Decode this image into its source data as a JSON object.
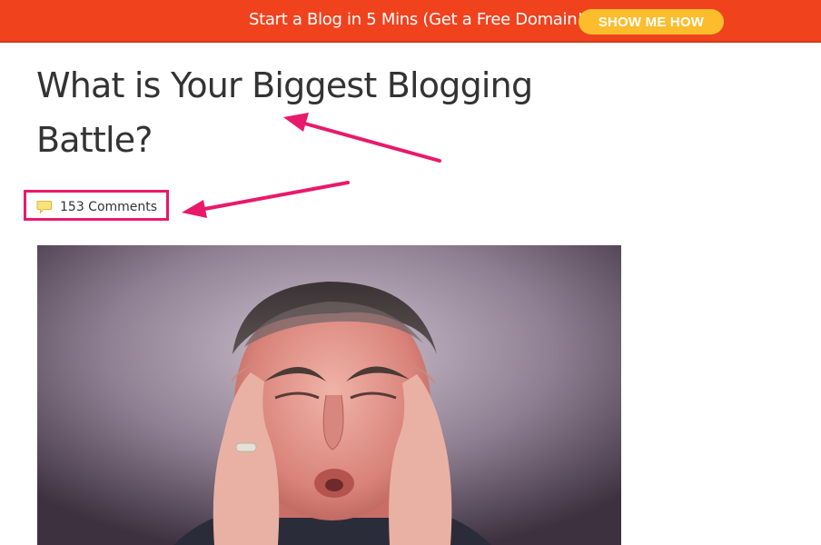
{
  "promo": {
    "text": "Start a Blog in 5 Mins (Get a Free Domain!)",
    "button_label": "SHOW ME HOW"
  },
  "post": {
    "title_line1": "What is Your Biggest Blogging",
    "title_line2": "Battle?",
    "comments_label": "153 Comments"
  },
  "colors": {
    "promo_bg": "#f1421e",
    "button_bg": "#fbbd2c",
    "annotation": "#e8196b"
  },
  "icons": {
    "comments": "speech-bubble-icon"
  }
}
